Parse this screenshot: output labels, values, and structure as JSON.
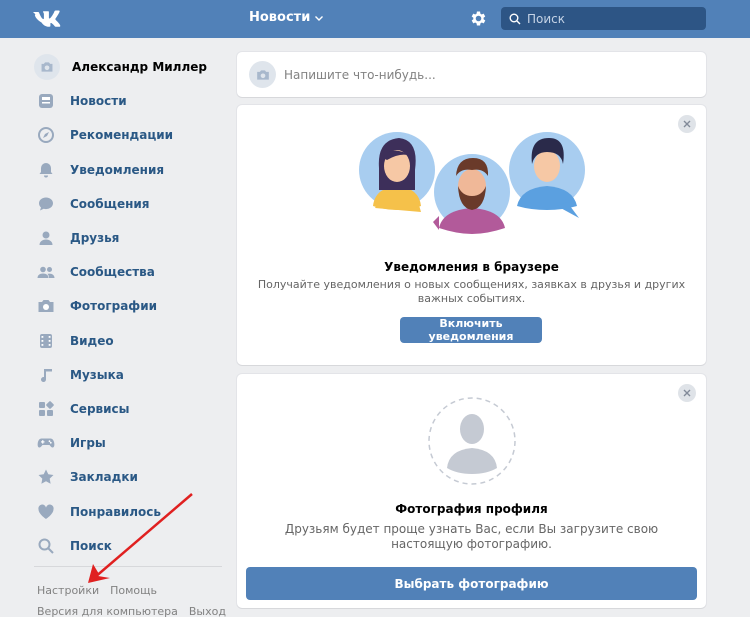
{
  "header": {
    "nav_title": "Новости",
    "search_placeholder": "Поиск",
    "brand_color": "#5181b8"
  },
  "sidebar": {
    "profile_name": "Александр Миллер",
    "items": [
      {
        "label": "Новости",
        "icon": "news-icon"
      },
      {
        "label": "Рекомендации",
        "icon": "compass-icon"
      },
      {
        "label": "Уведомления",
        "icon": "bell-icon"
      },
      {
        "label": "Сообщения",
        "icon": "chat-icon"
      },
      {
        "label": "Друзья",
        "icon": "person-icon"
      },
      {
        "label": "Сообщества",
        "icon": "group-icon"
      },
      {
        "label": "Фотографии",
        "icon": "camera-icon"
      },
      {
        "label": "Видео",
        "icon": "film-icon"
      },
      {
        "label": "Музыка",
        "icon": "music-icon"
      },
      {
        "label": "Сервисы",
        "icon": "grid-icon"
      },
      {
        "label": "Игры",
        "icon": "gamepad-icon"
      },
      {
        "label": "Закладки",
        "icon": "star-icon"
      },
      {
        "label": "Понравилось",
        "icon": "heart-icon"
      },
      {
        "label": "Поиск",
        "icon": "search-icon"
      }
    ],
    "footer": {
      "settings": "Настройки",
      "help": "Помощь",
      "desktop": "Версия для компьютера",
      "logout": "Выход"
    }
  },
  "compose": {
    "placeholder": "Напишите что-нибудь..."
  },
  "notif_card": {
    "title": "Уведомления в браузере",
    "text": "Получайте уведомления о новых сообщениях, заявках в друзья и других важных событиях.",
    "button": "Включить уведомления"
  },
  "photo_card": {
    "title": "Фотография профиля",
    "text": "Друзьям будет проще узнать Вас, если Вы загрузите свою настоящую фотографию.",
    "button": "Выбрать фотографию"
  }
}
